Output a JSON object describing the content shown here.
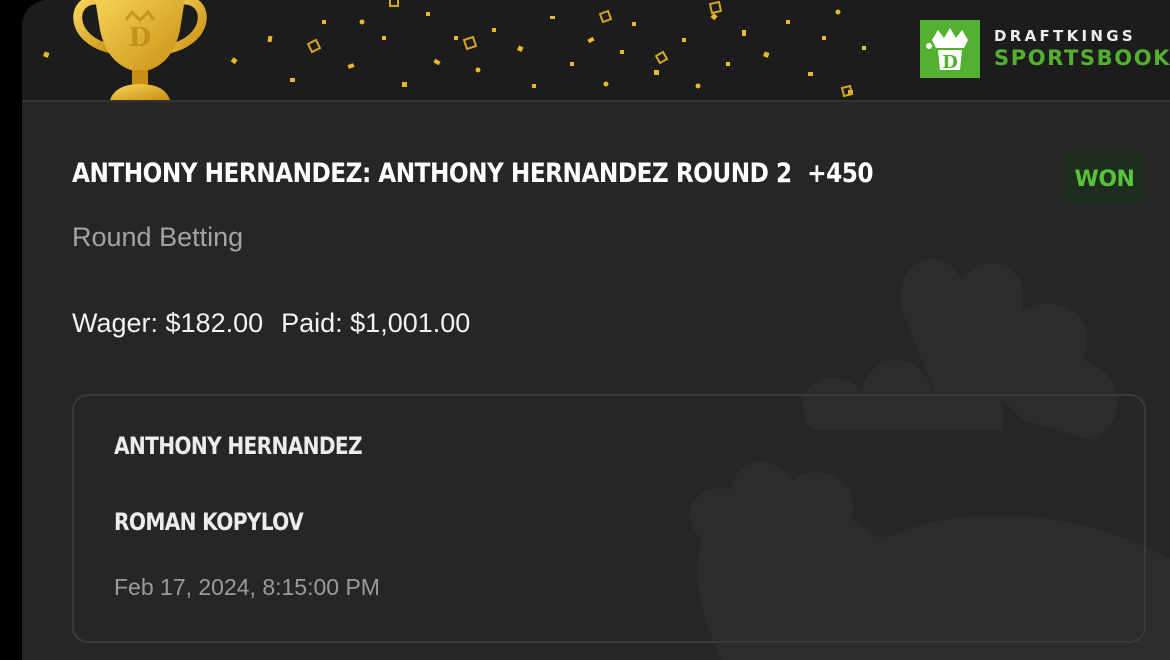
{
  "brand": {
    "line1": "DRAFTKINGS",
    "line2": "SPORTSBOOK",
    "logo_icon": "draftkings-crown-logo",
    "accent_color": "#53b030"
  },
  "banner": {
    "trophy_icon": "trophy-icon",
    "confetti_color": "#e9b82a"
  },
  "bet": {
    "title": "ANTHONY HERNANDEZ: ANTHONY HERNANDEZ ROUND 2",
    "odds": "+450",
    "status": "WON",
    "status_color": "#56c33b",
    "market": "Round Betting",
    "wager": "Wager: $182.00",
    "paid": "Paid: $1,001.00"
  },
  "event": {
    "competitor_1": "ANTHONY HERNANDEZ",
    "competitor_2": "ROMAN KOPYLOV",
    "date": "Feb 17, 2024, 8:15:00 PM"
  }
}
